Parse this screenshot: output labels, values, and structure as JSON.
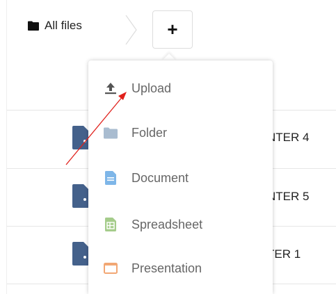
{
  "breadcrumb": {
    "label": "All files",
    "folder_icon": "folder-icon"
  },
  "toolbar": {
    "add_label": "+"
  },
  "files": [
    {
      "name_fragment": "NTER 4",
      "icon": "shared-file-icon"
    },
    {
      "name_fragment": "NTER 5",
      "icon": "shared-file-icon"
    },
    {
      "name_fragment": "TER 1",
      "icon": "shared-file-icon"
    }
  ],
  "new_menu": {
    "items": [
      {
        "label": "Upload",
        "icon": "upload-icon",
        "color": "#555555"
      },
      {
        "label": "Folder",
        "icon": "folder-icon",
        "color": "#a9bcd0"
      },
      {
        "label": "Document",
        "icon": "document-icon",
        "color": "#7eb6e8"
      },
      {
        "label": "Spreadsheet",
        "icon": "spreadsheet-icon",
        "color": "#a5cc8b"
      },
      {
        "label": "Presentation",
        "icon": "presentation-icon",
        "color": "#f2a774"
      }
    ]
  },
  "colors": {
    "annotation_arrow": "#e0201b",
    "file_icon": "#44618b"
  }
}
